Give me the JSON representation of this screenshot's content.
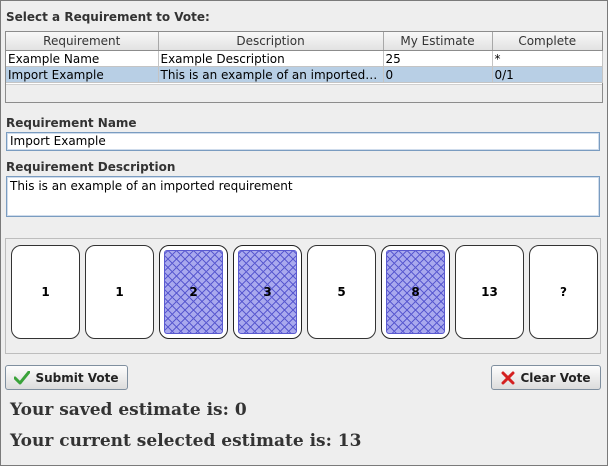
{
  "labels": {
    "select_requirement": "Select a Requirement to Vote:",
    "requirement_name": "Requirement Name",
    "requirement_description": "Requirement Description"
  },
  "table": {
    "headers": [
      "Requirement",
      "Description",
      "My Estimate",
      "Complete"
    ],
    "rows": [
      {
        "requirement": "Example Name",
        "description": "Example Description",
        "estimate": "25",
        "complete": "*"
      },
      {
        "requirement": "Import Example",
        "description": "This is an example of an imported req...",
        "estimate": "0",
        "complete": "0/1"
      }
    ]
  },
  "fields": {
    "name_value": "Import Example",
    "description_value": "This is an example of an imported requirement"
  },
  "cards": [
    {
      "label": "1",
      "face_down": false
    },
    {
      "label": "1",
      "face_down": false
    },
    {
      "label": "2",
      "face_down": true
    },
    {
      "label": "3",
      "face_down": true
    },
    {
      "label": "5",
      "face_down": false
    },
    {
      "label": "8",
      "face_down": true
    },
    {
      "label": "13",
      "face_down": false
    },
    {
      "label": "?",
      "face_down": false
    }
  ],
  "buttons": {
    "submit": "Submit Vote",
    "clear": "Clear Vote",
    "submit_icon": "check-icon",
    "clear_icon": "x-icon"
  },
  "status": {
    "saved": "Your saved estimate is: 0",
    "current": "Your current selected estimate is: 13"
  },
  "colors": {
    "selected_row": "#b8cfe5",
    "card_back": "#a9a9ee",
    "check": "#3aa33a",
    "x": "#d42020"
  }
}
